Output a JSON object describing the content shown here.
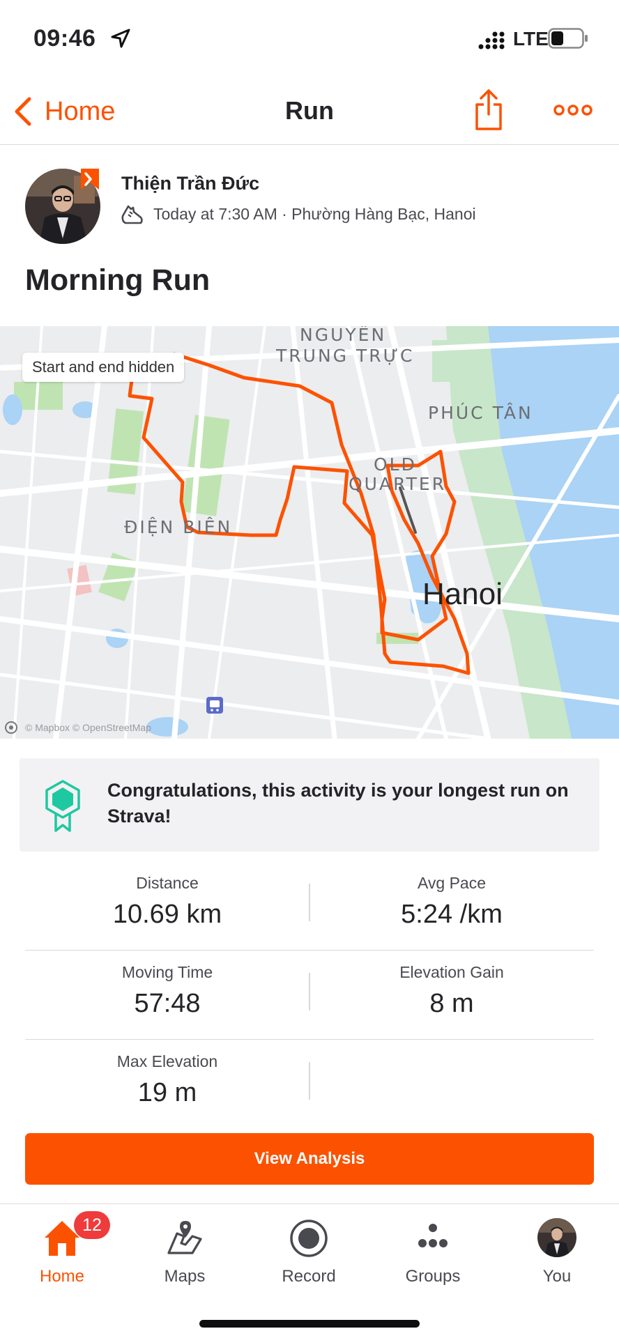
{
  "status_bar": {
    "time": "09:46",
    "network": "LTE",
    "battery_level": 0.4
  },
  "nav": {
    "back_label": "Home",
    "title": "Run"
  },
  "athlete": {
    "name": "Thiện Trần Đức",
    "meta": "Today at 7:30 AM · Phường Hàng Bạc, Hanoi"
  },
  "activity_title": "Morning Run",
  "map": {
    "notice": "Start and end hidden",
    "labels": {
      "north_1": "NGUYÊN",
      "north_2": "TRUNG TRỰC",
      "northeast": "PHÚC TÂN",
      "old_1": "OLD",
      "old_2": "QUARTER",
      "west": "ĐIỆN BIÊN",
      "city": "Hanoi"
    },
    "attribution": "© Mapbox © OpenStreetMap",
    "route_color": "#fc5200"
  },
  "achievement": {
    "text": "Congratulations, this activity is your longest run on Strava!",
    "icon": "achievement-badge-icon",
    "color": "#1ec8a0"
  },
  "stats": [
    {
      "label": "Distance",
      "value": "10.69 km"
    },
    {
      "label": "Avg Pace",
      "value": "5:24 /km"
    },
    {
      "label": "Moving Time",
      "value": "57:48"
    },
    {
      "label": "Elevation Gain",
      "value": "8 m"
    },
    {
      "label": "Max Elevation",
      "value": "19 m"
    }
  ],
  "analysis_button": "View Analysis",
  "tabs": [
    {
      "label": "Home",
      "icon": "home-icon",
      "badge": "12"
    },
    {
      "label": "Maps",
      "icon": "maps-icon"
    },
    {
      "label": "Record",
      "icon": "record-icon"
    },
    {
      "label": "Groups",
      "icon": "groups-icon"
    },
    {
      "label": "You",
      "icon": "avatar"
    }
  ],
  "colors": {
    "brand": "#fc5200",
    "badge": "#ef3b3b",
    "text": "#242428"
  }
}
